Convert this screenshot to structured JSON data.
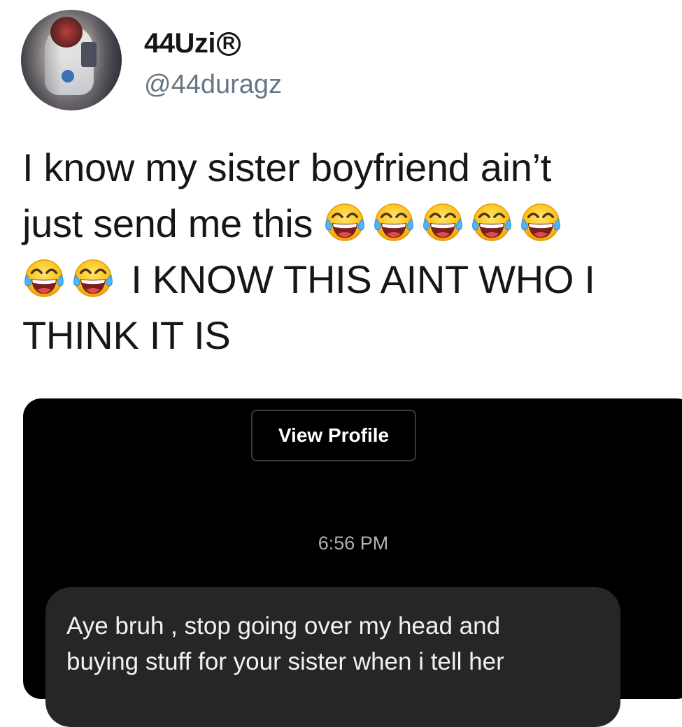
{
  "profile": {
    "display_name": "44Uzi",
    "badge_symbol": "R",
    "handle": "@44duragz"
  },
  "tweet": {
    "text_line1": "I know my sister boyfriend ain’t",
    "text_line2": "just send me this",
    "text_line3": "I KNOW THIS AINT WHO I",
    "text_line4": "THINK IT IS",
    "emoji_name": "face-with-tears-of-joy",
    "emoji_count_line2": 5,
    "emoji_count_line3": 2
  },
  "dm_screenshot": {
    "view_profile_label": "View Profile",
    "timestamp": "6:56 PM",
    "message_line1": "Aye bruh , stop going over my head and",
    "message_line2": "buying stuff for your sister when i tell her"
  },
  "colors": {
    "text_primary": "#14171a",
    "handle_gray": "#657786",
    "dm_background": "#000000",
    "bubble_background": "#262626"
  }
}
